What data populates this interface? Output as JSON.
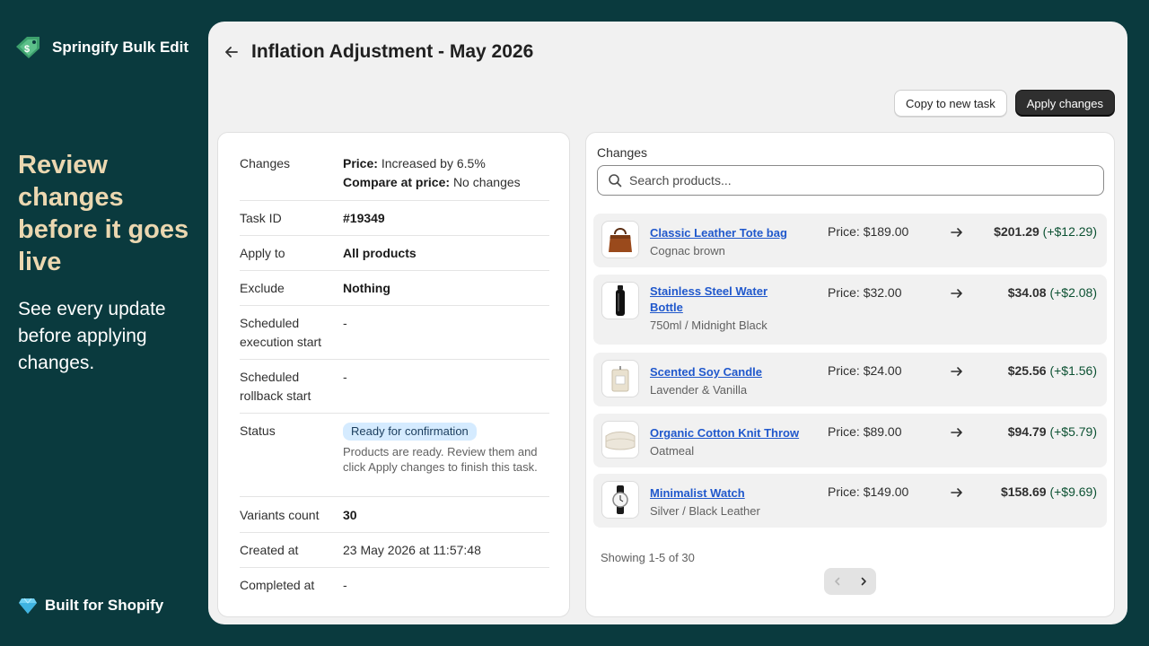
{
  "brand": {
    "name": "Springify Bulk Edit"
  },
  "marketing": {
    "headline": "Review changes before it goes live",
    "subhead": "See every update before applying changes.",
    "badge": "Built for Shopify"
  },
  "page": {
    "title": "Inflation Adjustment - May 2026",
    "copy_button": "Copy to new task",
    "apply_button": "Apply changes"
  },
  "details": {
    "changes_label": "Changes",
    "price_key": "Price:",
    "price_value": "Increased by 6.5%",
    "compare_key": "Compare at price:",
    "compare_value": "No changes",
    "task_id_label": "Task ID",
    "task_id": "#19349",
    "apply_to_label": "Apply to",
    "apply_to": "All products",
    "exclude_label": "Exclude",
    "exclude": "Nothing",
    "sched_exec_label": "Scheduled execution start",
    "sched_exec": "-",
    "sched_rollback_label": "Scheduled rollback start",
    "sched_rollback": "-",
    "status_label": "Status",
    "status_badge": "Ready for confirmation",
    "status_desc": "Products are ready. Review them and click Apply changes to finish this task.",
    "variants_label": "Variants count",
    "variants": "30",
    "created_label": "Created at",
    "created": "23 May 2026 at 11:57:48",
    "completed_label": "Completed at",
    "completed": "-"
  },
  "changes": {
    "heading": "Changes",
    "search_placeholder": "Search products...",
    "price_label": "Price:",
    "products": [
      {
        "name": "Classic Leather Tote bag",
        "variant": "Cognac brown",
        "old_price": "$189.00",
        "new_price": "$201.29",
        "diff": "(+$12.29)",
        "thumb_icon": "tote-bag-icon"
      },
      {
        "name": "Stainless Steel Water Bottle",
        "variant": "750ml / Midnight Black",
        "old_price": "$32.00",
        "new_price": "$34.08",
        "diff": "(+$2.08)",
        "thumb_icon": "water-bottle-icon"
      },
      {
        "name": "Scented Soy Candle",
        "variant": "Lavender & Vanilla",
        "old_price": "$24.00",
        "new_price": "$25.56",
        "diff": "(+$1.56)",
        "thumb_icon": "candle-icon"
      },
      {
        "name": "Organic Cotton Knit Throw",
        "variant": "Oatmeal",
        "old_price": "$89.00",
        "new_price": "$94.79",
        "diff": "(+$5.79)",
        "thumb_icon": "blanket-icon"
      },
      {
        "name": "Minimalist Watch",
        "variant": "Silver / Black Leather",
        "old_price": "$149.00",
        "new_price": "$158.69",
        "diff": "(+$9.69)",
        "thumb_icon": "watch-icon"
      }
    ],
    "showing": "Showing 1-5 of 30"
  },
  "colors": {
    "background": "#0a3a3e",
    "headline": "#ebd7b0",
    "link": "#2058cc",
    "diff_positive": "#0c5132",
    "badge_bg": "#d5ebff"
  }
}
